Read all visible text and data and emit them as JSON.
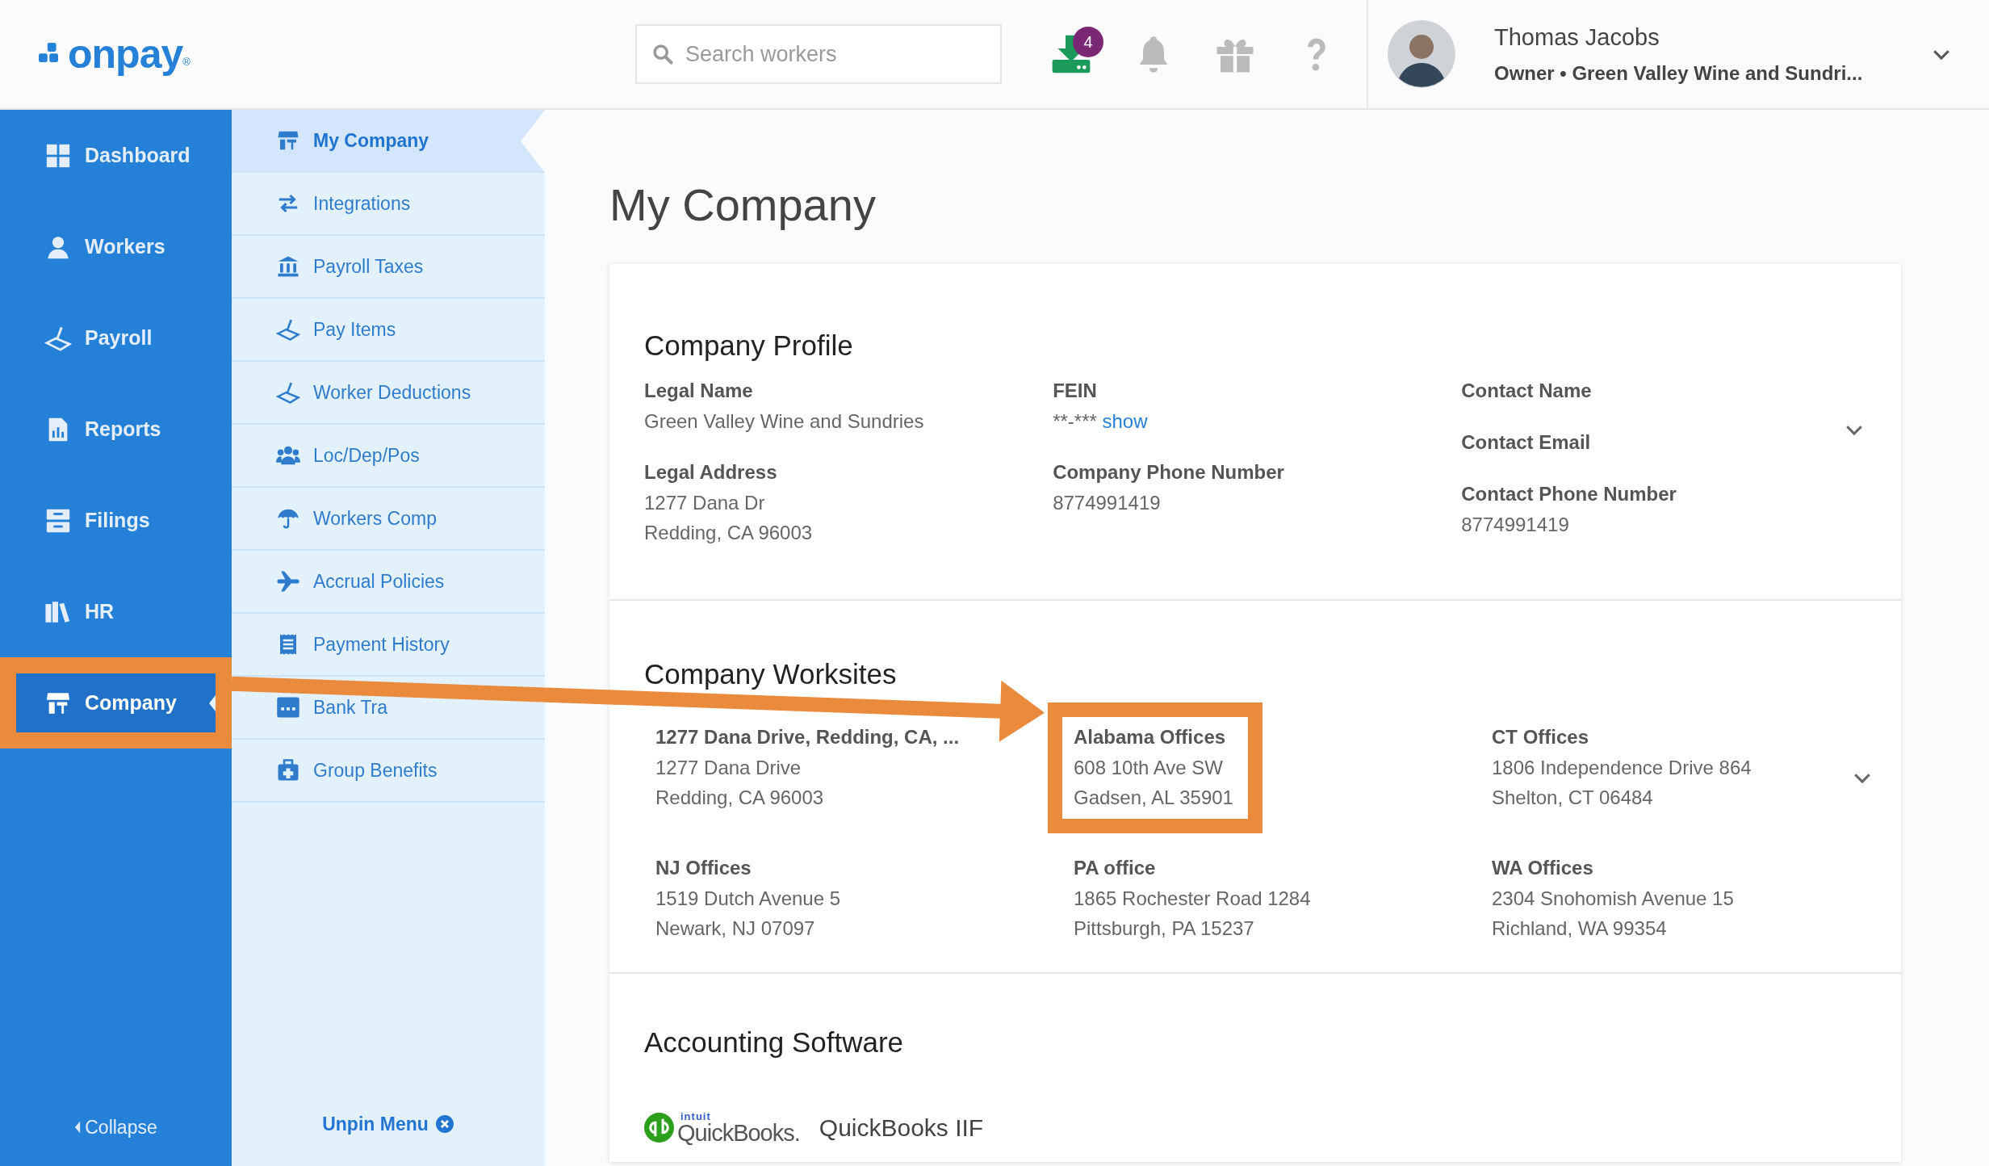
{
  "header": {
    "logo": "onpay",
    "logo_mark": "®",
    "search": {
      "placeholder": "Search workers"
    },
    "downloads_badge": "4",
    "user": {
      "name": "Thomas Jacobs",
      "subtitle": "Owner • Green Valley Wine and Sundri..."
    }
  },
  "nav": {
    "items": [
      {
        "label": "Dashboard",
        "selected": false,
        "highlighted": false
      },
      {
        "label": "Workers",
        "selected": false,
        "highlighted": false
      },
      {
        "label": "Payroll",
        "selected": false,
        "highlighted": false
      },
      {
        "label": "Reports",
        "selected": false,
        "highlighted": false
      },
      {
        "label": "Filings",
        "selected": false,
        "highlighted": false
      },
      {
        "label": "HR",
        "selected": false,
        "highlighted": false
      },
      {
        "label": "Company",
        "selected": true,
        "highlighted": true
      }
    ],
    "collapse": "Collapse"
  },
  "subnav": {
    "items": [
      {
        "label": "My Company",
        "selected": true
      },
      {
        "label": "Integrations",
        "selected": false
      },
      {
        "label": "Payroll Taxes",
        "selected": false
      },
      {
        "label": "Pay Items",
        "selected": false
      },
      {
        "label": "Worker Deductions",
        "selected": false
      },
      {
        "label": "Loc/Dep/Pos",
        "selected": false
      },
      {
        "label": "Workers Comp",
        "selected": false
      },
      {
        "label": "Accrual Policies",
        "selected": false
      },
      {
        "label": "Payment History",
        "selected": false
      },
      {
        "label": "Bank Tra",
        "selected": false
      },
      {
        "label": "Group Benefits",
        "selected": false
      }
    ],
    "unpin": "Unpin Menu"
  },
  "page_title": "My Company",
  "company_profile": {
    "title": "Company Profile",
    "columns": [
      [
        {
          "label": "Legal Name",
          "lines": [
            "Green Valley Wine and Sundries"
          ]
        },
        {
          "label": "Legal Address",
          "lines": [
            "1277 Dana Dr",
            "Redding, CA 96003"
          ]
        }
      ],
      [
        {
          "label": "FEIN",
          "lines": [
            "**-***"
          ],
          "link": "show"
        },
        {
          "label": "Company Phone Number",
          "lines": [
            "8774991419"
          ]
        }
      ],
      [
        {
          "label": "Contact Name"
        },
        {
          "label": "Contact Email"
        },
        {
          "label": "Contact Phone Number",
          "lines": [
            "8774991419"
          ]
        }
      ]
    ]
  },
  "company_worksites": {
    "title": "Company Worksites",
    "items": [
      {
        "name": "1277 Dana Drive, Redding, CA, ...",
        "lines": [
          "1277 Dana Drive",
          "Redding, CA 96003"
        ],
        "highlighted": false
      },
      {
        "name": "Alabama Offices",
        "lines": [
          "608 10th Ave SW",
          "Gadsen, AL 35901"
        ],
        "highlighted": true
      },
      {
        "name": "CT Offices",
        "lines": [
          "1806 Independence Drive 864",
          "Shelton, CT 06484"
        ],
        "highlighted": false
      },
      {
        "name": "NJ Offices",
        "lines": [
          "1519 Dutch Avenue 5",
          "Newark, NJ 07097"
        ],
        "highlighted": false
      },
      {
        "name": "PA office",
        "lines": [
          "1865 Rochester Road 1284",
          "Pittsburgh, PA 15237"
        ],
        "highlighted": false
      },
      {
        "name": "WA Offices",
        "lines": [
          "2304 Snohomish Avenue 15",
          "Richland, WA 99354"
        ],
        "highlighted": false
      }
    ]
  },
  "accounting_software": {
    "title": "Accounting Software",
    "logo_brand": "intuit",
    "logo_name": "QuickBooks.",
    "name": "QuickBooks IIF"
  }
}
